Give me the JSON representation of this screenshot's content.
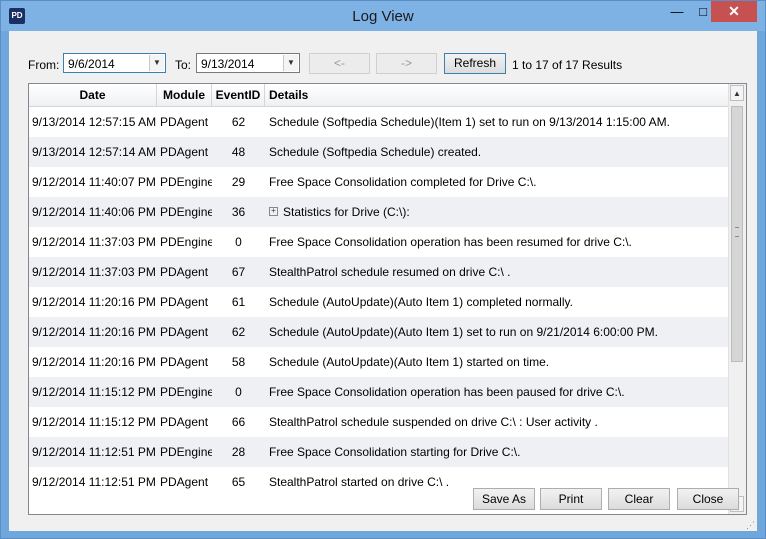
{
  "window": {
    "title": "Log View",
    "app_icon_text": "PD",
    "controls": {
      "minimize": "—",
      "maximize": "□",
      "close": "✕"
    }
  },
  "toolbar": {
    "from_label": "From:",
    "from_value": "9/6/2014",
    "to_label": "To:",
    "to_value": "9/13/2014",
    "prev_label": "<-",
    "next_label": "->",
    "refresh_label": "Refresh",
    "results_text": "1 to 17 of 17 Results"
  },
  "grid": {
    "columns": [
      "Date",
      "Module",
      "EventID",
      "Details"
    ],
    "rows": [
      {
        "date": "9/13/2014 12:57:15 AM",
        "module": "PDAgent",
        "event": "62",
        "details": "Schedule (Softpedia Schedule)(Item 1) set to run on 9/13/2014 1:15:00 AM."
      },
      {
        "date": "9/13/2014 12:57:14 AM",
        "module": "PDAgent",
        "event": "48",
        "details": "Schedule (Softpedia Schedule) created."
      },
      {
        "date": "9/12/2014 11:40:07 PM",
        "module": "PDEngine",
        "event": "29",
        "details": "Free Space Consolidation completed for Drive C:\\."
      },
      {
        "date": "9/12/2014 11:40:06 PM",
        "module": "PDEngine",
        "event": "36",
        "details": "Statistics for Drive (C:\\):",
        "expandable": true
      },
      {
        "date": "9/12/2014 11:37:03 PM",
        "module": "PDEngine",
        "event": "0",
        "details": "Free Space Consolidation operation has been resumed for drive C:\\."
      },
      {
        "date": "9/12/2014 11:37:03 PM",
        "module": "PDAgent",
        "event": "67",
        "details": "StealthPatrol schedule resumed on drive C:\\ ."
      },
      {
        "date": "9/12/2014 11:20:16 PM",
        "module": "PDAgent",
        "event": "61",
        "details": "Schedule (AutoUpdate)(Auto Item 1) completed normally."
      },
      {
        "date": "9/12/2014 11:20:16 PM",
        "module": "PDAgent",
        "event": "62",
        "details": "Schedule (AutoUpdate)(Auto Item 1) set to run on 9/21/2014 6:00:00 PM."
      },
      {
        "date": "9/12/2014 11:20:16 PM",
        "module": "PDAgent",
        "event": "58",
        "details": "Schedule (AutoUpdate)(Auto Item 1) started on time."
      },
      {
        "date": "9/12/2014 11:15:12 PM",
        "module": "PDEngine",
        "event": "0",
        "details": "Free Space Consolidation operation has been paused for drive C:\\."
      },
      {
        "date": "9/12/2014 11:15:12 PM",
        "module": "PDAgent",
        "event": "66",
        "details": "StealthPatrol schedule suspended on drive C:\\ :  User activity  ."
      },
      {
        "date": "9/12/2014 11:12:51 PM",
        "module": "PDEngine",
        "event": "28",
        "details": "Free Space Consolidation starting for Drive C:\\."
      },
      {
        "date": "9/12/2014 11:12:51 PM",
        "module": "PDAgent",
        "event": "65",
        "details": "StealthPatrol started on drive C:\\ ."
      }
    ]
  },
  "footer": {
    "save_as": "Save As",
    "print": "Print",
    "clear": "Clear",
    "close": "Close"
  },
  "colors": {
    "titlebar": "#7eb1e4",
    "close_button": "#c75050",
    "row_alt": "#eef0f4"
  }
}
